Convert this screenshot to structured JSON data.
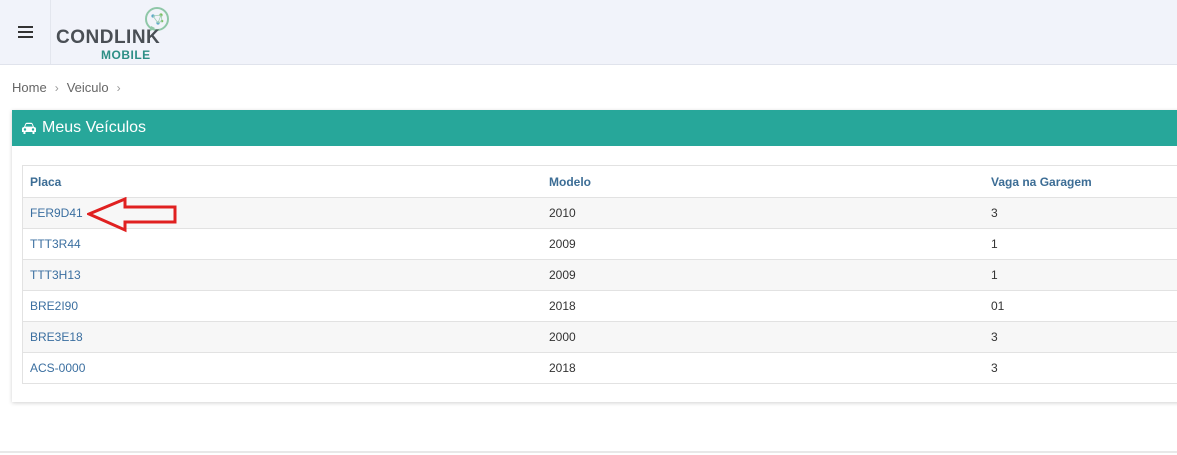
{
  "header": {
    "logo_main": "CONDLINK",
    "logo_sub": "MOBILE"
  },
  "breadcrumb": {
    "items": [
      "Home",
      "Veiculo"
    ]
  },
  "panel": {
    "title": "Meus Veículos",
    "accent_color": "#27a79a"
  },
  "table": {
    "columns": [
      "Placa",
      "Modelo",
      "Vaga na Garagem"
    ],
    "rows": [
      {
        "placa": "FER9D41",
        "modelo": "2010",
        "vaga": "3"
      },
      {
        "placa": "TTT3R44",
        "modelo": "2009",
        "vaga": "1"
      },
      {
        "placa": "TTT3H13",
        "modelo": "2009",
        "vaga": "1"
      },
      {
        "placa": "BRE2I90",
        "modelo": "2018",
        "vaga": "01"
      },
      {
        "placa": "BRE3E18",
        "modelo": "2000",
        "vaga": "3"
      },
      {
        "placa": "ACS-0000",
        "modelo": "2018",
        "vaga": "3"
      }
    ]
  },
  "annotation": {
    "arrow_color": "#e02020"
  }
}
